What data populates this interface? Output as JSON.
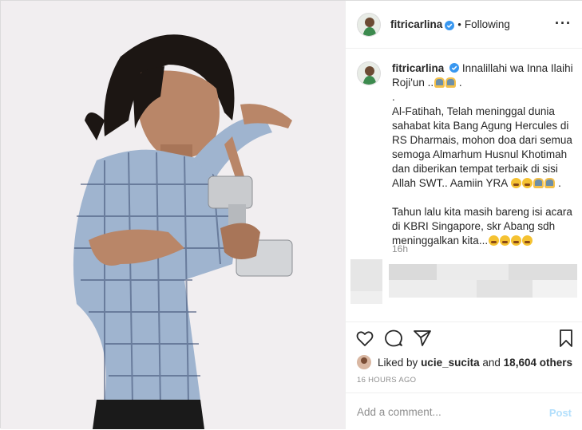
{
  "post": {
    "username": "fitricarlina",
    "follow_status": "Following",
    "separator": "•",
    "more_icon": "more-options-icon"
  },
  "caption": {
    "username": "fitricarlina",
    "line1": "Innalillahi wa Inna Ilaihi Roji'un ..",
    "line1_suffix": " .",
    "dot_line": ".",
    "para2": "Al-Fatihah, Telah meninggal dunia sahabat kita Bang Agung Hercules di RS Dharmais, mohon doa dari semua semoga Almarhum Husnul Khotimah dan diberikan tempat terbaik di sisi Allah SWT.. Aamiin YRA",
    "para2_suffix": " .",
    "para3": "Tahun lalu kita masih bareng isi acara di KBRI Singapore, skr Abang sdh meninggalkan kita...",
    "time": "16h"
  },
  "likes": {
    "prefix": "Liked by ",
    "user": "ucie_sucita",
    "middle": " and ",
    "count": "18,604 others"
  },
  "timestamp": "16 HOURS AGO",
  "comment_box": {
    "placeholder": "Add a comment...",
    "post_label": "Post"
  },
  "colors": {
    "verified": "#3897f0",
    "post_disabled": "#b2dffc",
    "muted": "#8e8e8e"
  }
}
